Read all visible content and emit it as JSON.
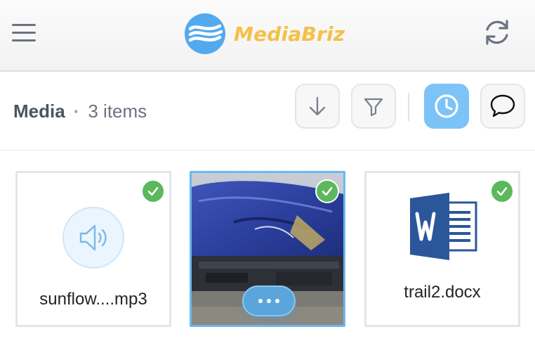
{
  "header": {
    "menu_icon": "hamburger-menu-icon",
    "logo_text": "MediaBriz",
    "logo_icon": "waves-logo-icon",
    "refresh_icon": "refresh-icon"
  },
  "toolbar": {
    "title": "Media",
    "separator": "·",
    "count": "3 items",
    "buttons": [
      {
        "icon": "download-arrow-icon",
        "active": false
      },
      {
        "icon": "filter-funnel-icon",
        "active": false
      },
      {
        "icon": "clock-icon",
        "active": true
      },
      {
        "icon": "chat-bubble-icon",
        "active": false
      }
    ]
  },
  "items": [
    {
      "name": "sunflow....mp3",
      "type": "audio",
      "selected": false,
      "checked": true,
      "icon": "speaker-icon"
    },
    {
      "name": "",
      "type": "image",
      "selected": true,
      "checked": true,
      "icon": "photo-thumbnail",
      "action_icon": "more-dots-icon"
    },
    {
      "name": "trail2.docx",
      "type": "document",
      "selected": false,
      "checked": true,
      "icon": "word-document-icon"
    }
  ],
  "colors": {
    "brand_blue": "#53a9ee",
    "brand_yellow": "#f4c047",
    "active_button": "#7cc4f7",
    "check_green": "#5cb85c",
    "selected_border": "#6ab8f0",
    "word_blue": "#2b579a"
  }
}
